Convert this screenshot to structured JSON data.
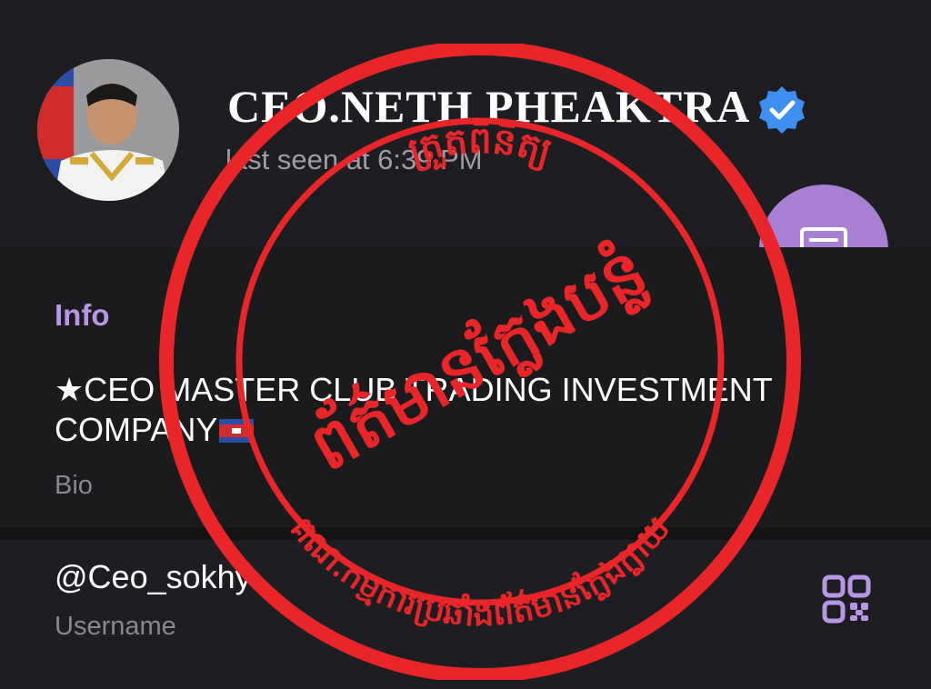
{
  "profile": {
    "name": "CEO.NETH PHEAKTRA",
    "status": "last seen at 6:39 PM",
    "verified": true
  },
  "info": {
    "section_title": "Info",
    "bio": "★CEO MASTER CLUB TRADING INVESTMENT COMPANY",
    "bio_label": "Bio",
    "username": "@Ceo_sokhy",
    "username_label": "Username"
  },
  "stamp": {
    "top_text": "ត្រួតពិនិត្យ",
    "center_text": "ព័ត៌មានក្លែងបន្លំ",
    "bottom_text": "គណៈកម្មការប្រឆាំងព័ត៌មានក្លែងក្លាយ",
    "color": "#e8262a"
  },
  "colors": {
    "accent": "#b896e6",
    "fab": "#a77fd3",
    "verified_badge": "#3d8ff2",
    "background": "#1b1a1d"
  },
  "icons": {
    "verified": "verified-check-icon",
    "message": "message-icon",
    "qr": "qr-code-icon"
  }
}
